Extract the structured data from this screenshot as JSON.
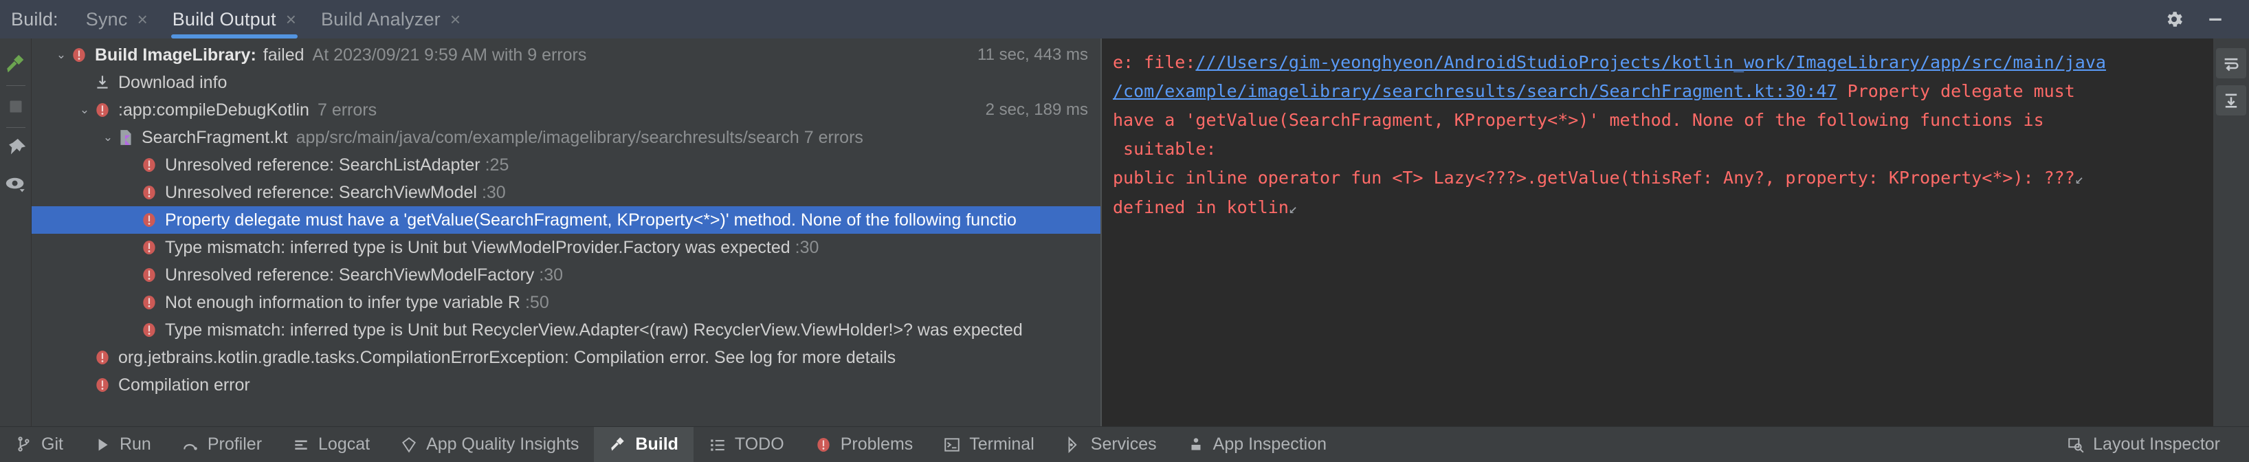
{
  "window": {
    "tool_window_label": "Build:",
    "tabs": [
      {
        "label": "Sync",
        "close": "×",
        "active": false
      },
      {
        "label": "Build Output",
        "close": "×",
        "active": true
      },
      {
        "label": "Build Analyzer",
        "close": "×",
        "active": false
      }
    ],
    "right_icons": [
      {
        "name": "settings-gear-icon"
      },
      {
        "name": "minimize-icon"
      }
    ]
  },
  "left_toolbar": [
    {
      "name": "build-hammer-icon",
      "color": "#6ca550"
    },
    {
      "name": "stop-square-icon",
      "color": "#5e6163"
    },
    {
      "name": "pin-icon",
      "color": "#aeb2b6"
    },
    {
      "name": "eye-filter-icon",
      "color": "#aeb2b6"
    }
  ],
  "tree": {
    "rows": [
      {
        "indent": 0,
        "arrow": "⌄",
        "icon": "error-icon",
        "text": "Build ImageLibrary:",
        "bold": true,
        "text2": "failed",
        "sub": "At 2023/09/21 9:59 AM with 9 errors",
        "time": "11 sec, 443 ms",
        "selected": false
      },
      {
        "indent": 1,
        "arrow": "",
        "icon": "download-icon",
        "text": "Download info",
        "bold": false,
        "text2": "",
        "sub": "",
        "time": "",
        "selected": false
      },
      {
        "indent": 1,
        "arrow": "⌄",
        "icon": "error-icon",
        "text": ":app:compileDebugKotlin",
        "bold": false,
        "text2": "",
        "sub": "7 errors",
        "time": "2 sec, 189 ms",
        "selected": false
      },
      {
        "indent": 2,
        "arrow": "⌄",
        "icon": "kotlin-file-icon",
        "text": "SearchFragment.kt",
        "bold": false,
        "text2": "",
        "sub": "app/src/main/java/com/example/imagelibrary/searchresults/search 7 errors",
        "time": "",
        "selected": false
      },
      {
        "indent": 3,
        "arrow": "",
        "icon": "error-icon",
        "text": "Unresolved reference: SearchListAdapter",
        "bold": false,
        "text2": "",
        "sub": ":25",
        "time": "",
        "selected": false
      },
      {
        "indent": 3,
        "arrow": "",
        "icon": "error-icon",
        "text": "Unresolved reference: SearchViewModel",
        "bold": false,
        "text2": "",
        "sub": ":30",
        "time": "",
        "selected": false
      },
      {
        "indent": 3,
        "arrow": "",
        "icon": "error-icon",
        "text": "Property delegate must have a 'getValue(SearchFragment, KProperty<*>)' method. None of the following functio",
        "bold": false,
        "text2": "",
        "sub": "",
        "time": "",
        "selected": true
      },
      {
        "indent": 3,
        "arrow": "",
        "icon": "error-icon",
        "text": "Type mismatch: inferred type is Unit but ViewModelProvider.Factory was expected",
        "bold": false,
        "text2": "",
        "sub": ":30",
        "time": "",
        "selected": false
      },
      {
        "indent": 3,
        "arrow": "",
        "icon": "error-icon",
        "text": "Unresolved reference: SearchViewModelFactory",
        "bold": false,
        "text2": "",
        "sub": ":30",
        "time": "",
        "selected": false
      },
      {
        "indent": 3,
        "arrow": "",
        "icon": "error-icon",
        "text": "Not enough information to infer type variable R",
        "bold": false,
        "text2": "",
        "sub": ":50",
        "time": "",
        "selected": false
      },
      {
        "indent": 3,
        "arrow": "",
        "icon": "error-icon",
        "text": "Type mismatch: inferred type is Unit but RecyclerView.Adapter<(raw) RecyclerView.ViewHolder!>? was expected",
        "bold": false,
        "text2": "",
        "sub": "",
        "time": "",
        "selected": false
      },
      {
        "indent": 1,
        "arrow": "",
        "icon": "error-icon",
        "text": "org.jetbrains.kotlin.gradle.tasks.CompilationErrorException: Compilation error. See log for more details",
        "bold": false,
        "text2": "",
        "sub": "",
        "time": "",
        "selected": false
      },
      {
        "indent": 1,
        "arrow": "",
        "icon": "error-icon",
        "text": "Compilation error",
        "bold": false,
        "text2": "",
        "sub": "",
        "time": "",
        "selected": false
      }
    ]
  },
  "console": {
    "lines": [
      {
        "prefix": "e: file:",
        "link": "///Users/gim-yeonghyeon/AndroidStudioProjects/kotlin_work/ImageLibrary/app/src/main/java",
        "suffix": "",
        "mark": ""
      },
      {
        "prefix": "",
        "link": "/com/example/imagelibrary/searchresults/search/SearchFragment.kt:30:47",
        "suffix": " Property delegate must",
        "mark": ""
      },
      {
        "prefix": "have a 'getValue(SearchFragment, KProperty<*>)' method. None of the following functions is",
        "link": "",
        "suffix": "",
        "mark": ""
      },
      {
        "prefix": " suitable:",
        "link": "",
        "suffix": "",
        "mark": ""
      },
      {
        "prefix": "public inline operator fun <T> Lazy<???>.getValue(thisRef: Any?, property: KProperty<*>): ???",
        "link": "",
        "suffix": "",
        "mark": "↙"
      },
      {
        "prefix": "defined in kotlin",
        "link": "",
        "suffix": "",
        "mark": "↙"
      }
    ],
    "right_tools": [
      {
        "name": "soft-wrap-icon"
      },
      {
        "name": "scroll-to-end-icon"
      }
    ]
  },
  "statusbar": {
    "left_items": [
      {
        "label": "Git",
        "icon": "git-branch-icon",
        "active": false
      },
      {
        "label": "Run",
        "icon": "run-play-icon",
        "active": false
      },
      {
        "label": "Profiler",
        "icon": "profiler-icon",
        "active": false
      },
      {
        "label": "Logcat",
        "icon": "logcat-list-icon",
        "active": false
      },
      {
        "label": "App Quality Insights",
        "icon": "diamond-icon",
        "active": false
      },
      {
        "label": "Build",
        "icon": "build-hammer-icon",
        "active": true
      },
      {
        "label": "TODO",
        "icon": "todo-list-icon",
        "active": false
      },
      {
        "label": "Problems",
        "icon": "error-icon",
        "active": false
      },
      {
        "label": "Terminal",
        "icon": "terminal-icon",
        "active": false
      },
      {
        "label": "Services",
        "icon": "services-icon",
        "active": false
      },
      {
        "label": "App Inspection",
        "icon": "app-inspection-icon",
        "active": false
      }
    ],
    "right_items": [
      {
        "label": "Layout Inspector",
        "icon": "layout-inspector-icon",
        "active": false
      }
    ]
  },
  "colors": {
    "accent": "#5394e0",
    "selection": "#3b6cc4",
    "error": "#cc5a56",
    "link": "#5a9bf8",
    "console_text": "#ff6b68"
  }
}
